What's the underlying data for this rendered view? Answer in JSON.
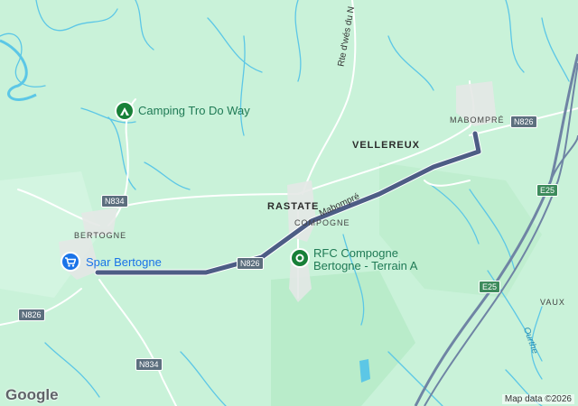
{
  "map": {
    "places": {
      "rastate": "RASTATE",
      "compogne": "COMPOGNE",
      "vellereux": "VELLEREUX",
      "mabompre": "MABOMPRÉ",
      "bertogne": "BERTOGNE",
      "vaux": "VAUX"
    },
    "pois": {
      "camping": "Camping Tro Do Way",
      "spar": "Spar Bertogne",
      "rfc_line1": "RFC Compogne",
      "rfc_line2": "Bertogne - Terrain A"
    },
    "roads": {
      "mabompre_road": "Mabompré",
      "rte_dwes": "Rte d'wés du N",
      "n826_a": "N826",
      "n826_b": "N826",
      "n826_c": "N826",
      "n834_a": "N834",
      "n834_b": "N834",
      "e25_a": "E25",
      "e25_b": "E25"
    },
    "river": "Ourthe",
    "attribution": "Map data ©2026",
    "logo": "Google",
    "colors": {
      "land": "#c9f2d9",
      "water": "#5cc7e6",
      "route": "#4d5d85",
      "motorway": "#6f84a4",
      "road": "#ffffff",
      "poi_green": "#188038",
      "poi_blue": "#1a73e8"
    }
  }
}
